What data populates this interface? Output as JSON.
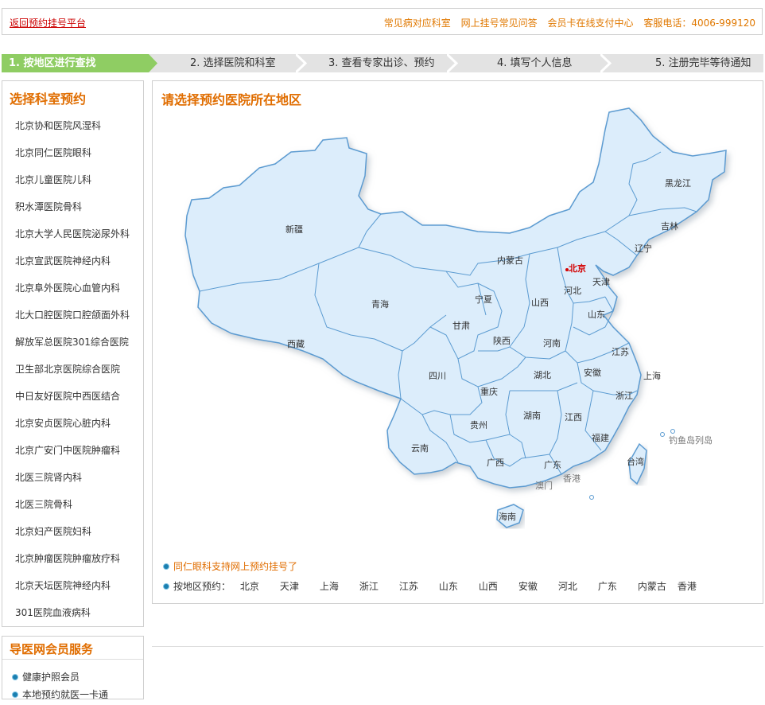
{
  "topbar": {
    "back_link": "返回预约挂号平台",
    "links": [
      "常见病对应科室",
      "网上挂号常见问答",
      "会员卡在线支付中心",
      "客服电话：4006-999120"
    ]
  },
  "steps": [
    "1. 按地区进行查找",
    "2. 选择医院和科室",
    "3. 查看专家出诊、预约",
    "4. 填写个人信息",
    "5. 注册完毕等待通知"
  ],
  "sidebar": {
    "title": "选择科室预约",
    "items": [
      "北京协和医院风湿科",
      "北京同仁医院眼科",
      "北京儿童医院儿科",
      "积水潭医院骨科",
      "北京大学人民医院泌尿外科",
      "北京宣武医院神经内科",
      "北京阜外医院心血管内科",
      "北大口腔医院口腔颌面外科",
      "解放军总医院301综合医院",
      "卫生部北京医院综合医院",
      "中日友好医院中西医结合",
      "北京安贞医院心脏内科",
      "北京广安门中医院肿瘤科",
      "北医三院肾内科",
      "北医三院骨科",
      "北京妇产医院妇科",
      "北京肿瘤医院肿瘤放疗科",
      "北京天坛医院神经内科",
      "301医院血液病科"
    ]
  },
  "member": {
    "title": "导医网会员服务",
    "items": [
      "健康护照会员",
      "本地预约就医一卡通"
    ]
  },
  "main": {
    "title": "请选择预约医院所在地区",
    "notice": "同仁眼科支持网上预约挂号了",
    "region_label": "按地区预约：",
    "regions": [
      "北京",
      "天津",
      "上海",
      "浙江",
      "江苏",
      "山东",
      "山西",
      "安徽",
      "河北",
      "广东",
      "内蒙古",
      "香港"
    ]
  },
  "map": {
    "highlight": "北京",
    "provinces": [
      "新疆",
      "西藏",
      "青海",
      "内蒙古",
      "黑龙江",
      "吉林",
      "辽宁",
      "北京",
      "天津",
      "河北",
      "山西",
      "山东",
      "宁夏",
      "甘肃",
      "陕西",
      "河南",
      "江苏",
      "上海",
      "安徽",
      "湖北",
      "四川",
      "重庆",
      "浙江",
      "贵州",
      "湖南",
      "江西",
      "福建",
      "云南",
      "广西",
      "广东",
      "台湾",
      "香港",
      "澳门",
      "海南",
      "钓鱼岛列岛"
    ],
    "colors": {
      "land": "#dcedfb",
      "border": "#5b9bd1",
      "highlight": "#d40000",
      "label": "#333333",
      "minor_label": "#777777"
    }
  },
  "colors": {
    "accent": "#e06d00",
    "active_step": "#8fcd63",
    "link_red": "#cc0000"
  }
}
